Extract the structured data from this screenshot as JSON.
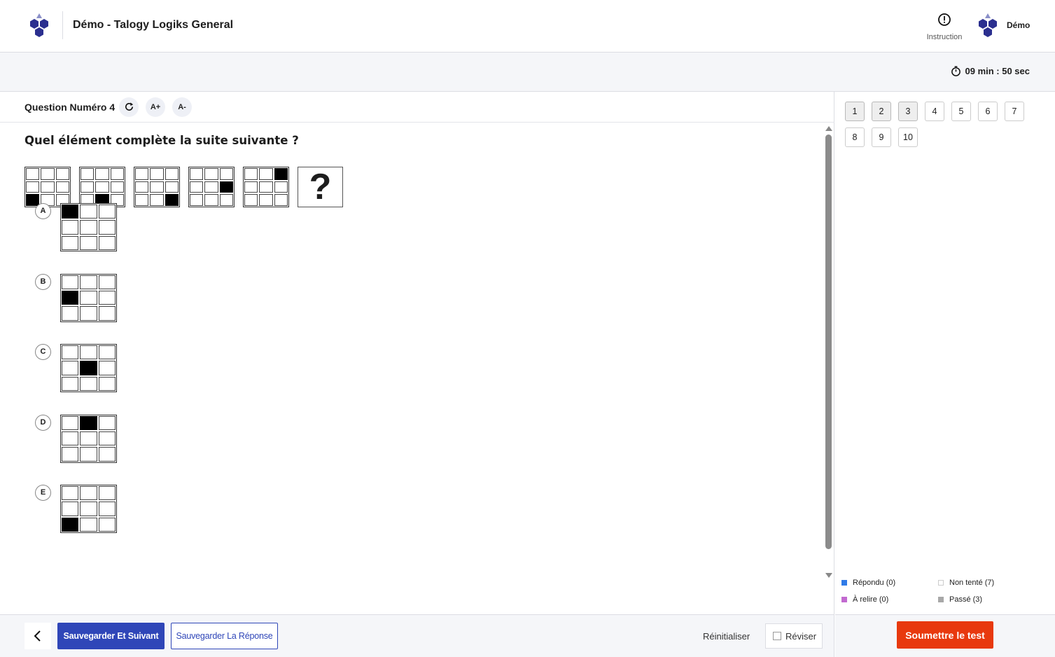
{
  "header": {
    "app_title": "Démo - Talogy Logiks General",
    "instruction_label": "Instruction",
    "user_name": "Démo",
    "logo_icon": "hexagon-logo-icon",
    "brand_color": "#2b2f8f"
  },
  "timer": {
    "text": "09 min : 50 sec",
    "icon": "stopwatch-icon"
  },
  "question": {
    "number_label": "Question Numéro 4",
    "font_increase": "A+",
    "font_decrease": "A-",
    "text": "Quel élément complète la suite suivante ?",
    "sequence": [
      [
        0,
        0,
        0,
        0,
        0,
        0,
        1,
        0,
        0
      ],
      [
        0,
        0,
        0,
        0,
        0,
        0,
        0,
        1,
        0
      ],
      [
        0,
        0,
        0,
        0,
        0,
        0,
        0,
        0,
        1
      ],
      [
        0,
        0,
        0,
        0,
        0,
        1,
        0,
        0,
        0
      ],
      [
        0,
        0,
        1,
        0,
        0,
        0,
        0,
        0,
        0
      ]
    ],
    "missing_symbol": "?",
    "options": [
      {
        "letter": "A",
        "cells": [
          1,
          0,
          0,
          0,
          0,
          0,
          0,
          0,
          0
        ]
      },
      {
        "letter": "B",
        "cells": [
          0,
          0,
          0,
          1,
          0,
          0,
          0,
          0,
          0
        ]
      },
      {
        "letter": "C",
        "cells": [
          0,
          0,
          0,
          0,
          1,
          0,
          0,
          0,
          0
        ]
      },
      {
        "letter": "D",
        "cells": [
          0,
          1,
          0,
          0,
          0,
          0,
          0,
          0,
          0
        ]
      },
      {
        "letter": "E",
        "cells": [
          0,
          0,
          0,
          0,
          0,
          0,
          1,
          0,
          0
        ]
      }
    ]
  },
  "footer": {
    "save_next": "Sauvegarder Et Suivant",
    "save_answer": "Sauvegarder La Réponse",
    "reset": "Réinitialiser",
    "review": "Réviser",
    "primary_color": "#2f46b8"
  },
  "navigator": {
    "questions": [
      {
        "label": "1",
        "status": "passed"
      },
      {
        "label": "2",
        "status": "passed"
      },
      {
        "label": "3",
        "status": "passed"
      },
      {
        "label": "4",
        "status": "not_attempted"
      },
      {
        "label": "5",
        "status": "not_attempted"
      },
      {
        "label": "6",
        "status": "not_attempted"
      },
      {
        "label": "7",
        "status": "not_attempted"
      },
      {
        "label": "8",
        "status": "not_attempted"
      },
      {
        "label": "9",
        "status": "not_attempted"
      },
      {
        "label": "10",
        "status": "not_attempted"
      }
    ],
    "legend": [
      {
        "label": "Répondu (0)",
        "color": "#2f7be8"
      },
      {
        "label": "Non tenté (7)",
        "color": "#ffffff"
      },
      {
        "label": "À relire (0)",
        "color": "#c26ad0"
      },
      {
        "label": "Passé (3)",
        "color": "#a8a8a8"
      }
    ],
    "submit_label": "Soumettre le test",
    "submit_color": "#e8390e"
  }
}
